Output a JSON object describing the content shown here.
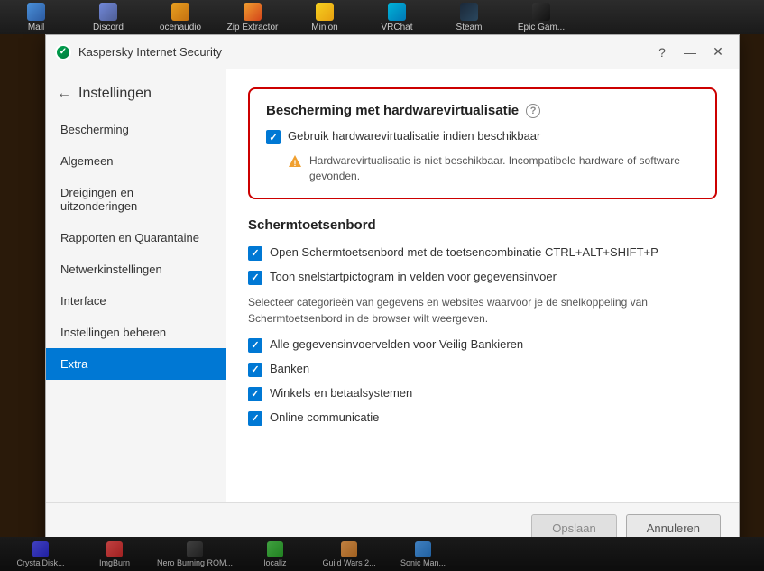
{
  "taskbar": {
    "apps": [
      {
        "id": "mail",
        "label": "Mail",
        "icon_class": "taskbar-icon-mail"
      },
      {
        "id": "discord",
        "label": "Discord",
        "icon_class": "taskbar-icon-discord"
      },
      {
        "id": "ocenaudio",
        "label": "ocenaudio",
        "icon_class": "taskbar-icon-ocenaudio"
      },
      {
        "id": "zipextractor",
        "label": "Zip Extractor",
        "icon_class": "taskbar-icon-zipextractor"
      },
      {
        "id": "minion",
        "label": "Minion",
        "icon_class": "taskbar-icon-minion"
      },
      {
        "id": "vrchat",
        "label": "VRChat",
        "icon_class": "taskbar-icon-vrchat"
      },
      {
        "id": "steam",
        "label": "Steam",
        "icon_class": "taskbar-icon-steam"
      },
      {
        "id": "epic",
        "label": "Epic Gam...",
        "icon_class": "taskbar-icon-epic"
      }
    ]
  },
  "titlebar": {
    "title": "Kaspersky Internet Security",
    "help_btn": "?",
    "minimize_btn": "—",
    "close_btn": "✕"
  },
  "sidebar": {
    "back_label": "Instellingen",
    "items": [
      {
        "id": "bescherming",
        "label": "Bescherming",
        "active": false
      },
      {
        "id": "algemeen",
        "label": "Algemeen",
        "active": false
      },
      {
        "id": "dreigingen",
        "label": "Dreigingen en uitzonderingen",
        "active": false
      },
      {
        "id": "rapporten",
        "label": "Rapporten en Quarantaine",
        "active": false
      },
      {
        "id": "netwerk",
        "label": "Netwerkinstellingen",
        "active": false
      },
      {
        "id": "interface",
        "label": "Interface",
        "active": false
      },
      {
        "id": "instellingen-beheren",
        "label": "Instellingen beheren",
        "active": false
      },
      {
        "id": "extra",
        "label": "Extra",
        "active": true
      }
    ]
  },
  "main": {
    "hw_section": {
      "title": "Bescherming met hardwarevirtualisatie",
      "checkbox_label": "Gebruik hardwarevirtualisatie indien beschikbaar",
      "warning_text": "Hardwarevirtualisatie is niet beschikbaar. Incompatibele hardware of software gevonden."
    },
    "skb_section": {
      "title": "Schermtoetsenbord",
      "checkbox1_label": "Open Schermtoetsenbord met de toetsencombinatie CTRL+ALT+SHIFT+P",
      "checkbox2_label": "Toon snelstartpictogram in velden voor gegevensinvoer",
      "info_text": "Selecteer categorieën van gegevens en websites waarvoor je de snelkoppeling van Schermtoetsenbord in de browser wilt weergeven.",
      "checkbox3_label": "Alle gegevensinvoervelden voor Veilig Bankieren",
      "checkbox4_label": "Banken",
      "checkbox5_label": "Winkels en betaalsystemen",
      "checkbox6_label": "Online communicatie"
    }
  },
  "footer": {
    "save_label": "Opslaan",
    "cancel_label": "Annuleren"
  },
  "taskbar_bottom": {
    "apps": [
      {
        "id": "crystaldisk",
        "label": "CrystalDisk...",
        "icon_class": "tb-icon-crystaldisk"
      },
      {
        "id": "imgburn",
        "label": "ImgBurn",
        "icon_class": "tb-icon-imgburn"
      },
      {
        "id": "nero",
        "label": "Nero Burning ROM...",
        "icon_class": "tb-icon-nero"
      },
      {
        "id": "locale",
        "label": "localiz",
        "icon_class": "tb-icon-locale"
      },
      {
        "id": "guild",
        "label": "Guild Wars 2...",
        "icon_class": "tb-icon-guild"
      },
      {
        "id": "sonic",
        "label": "Sonic Man...",
        "icon_class": "tb-icon-sonic"
      }
    ]
  }
}
